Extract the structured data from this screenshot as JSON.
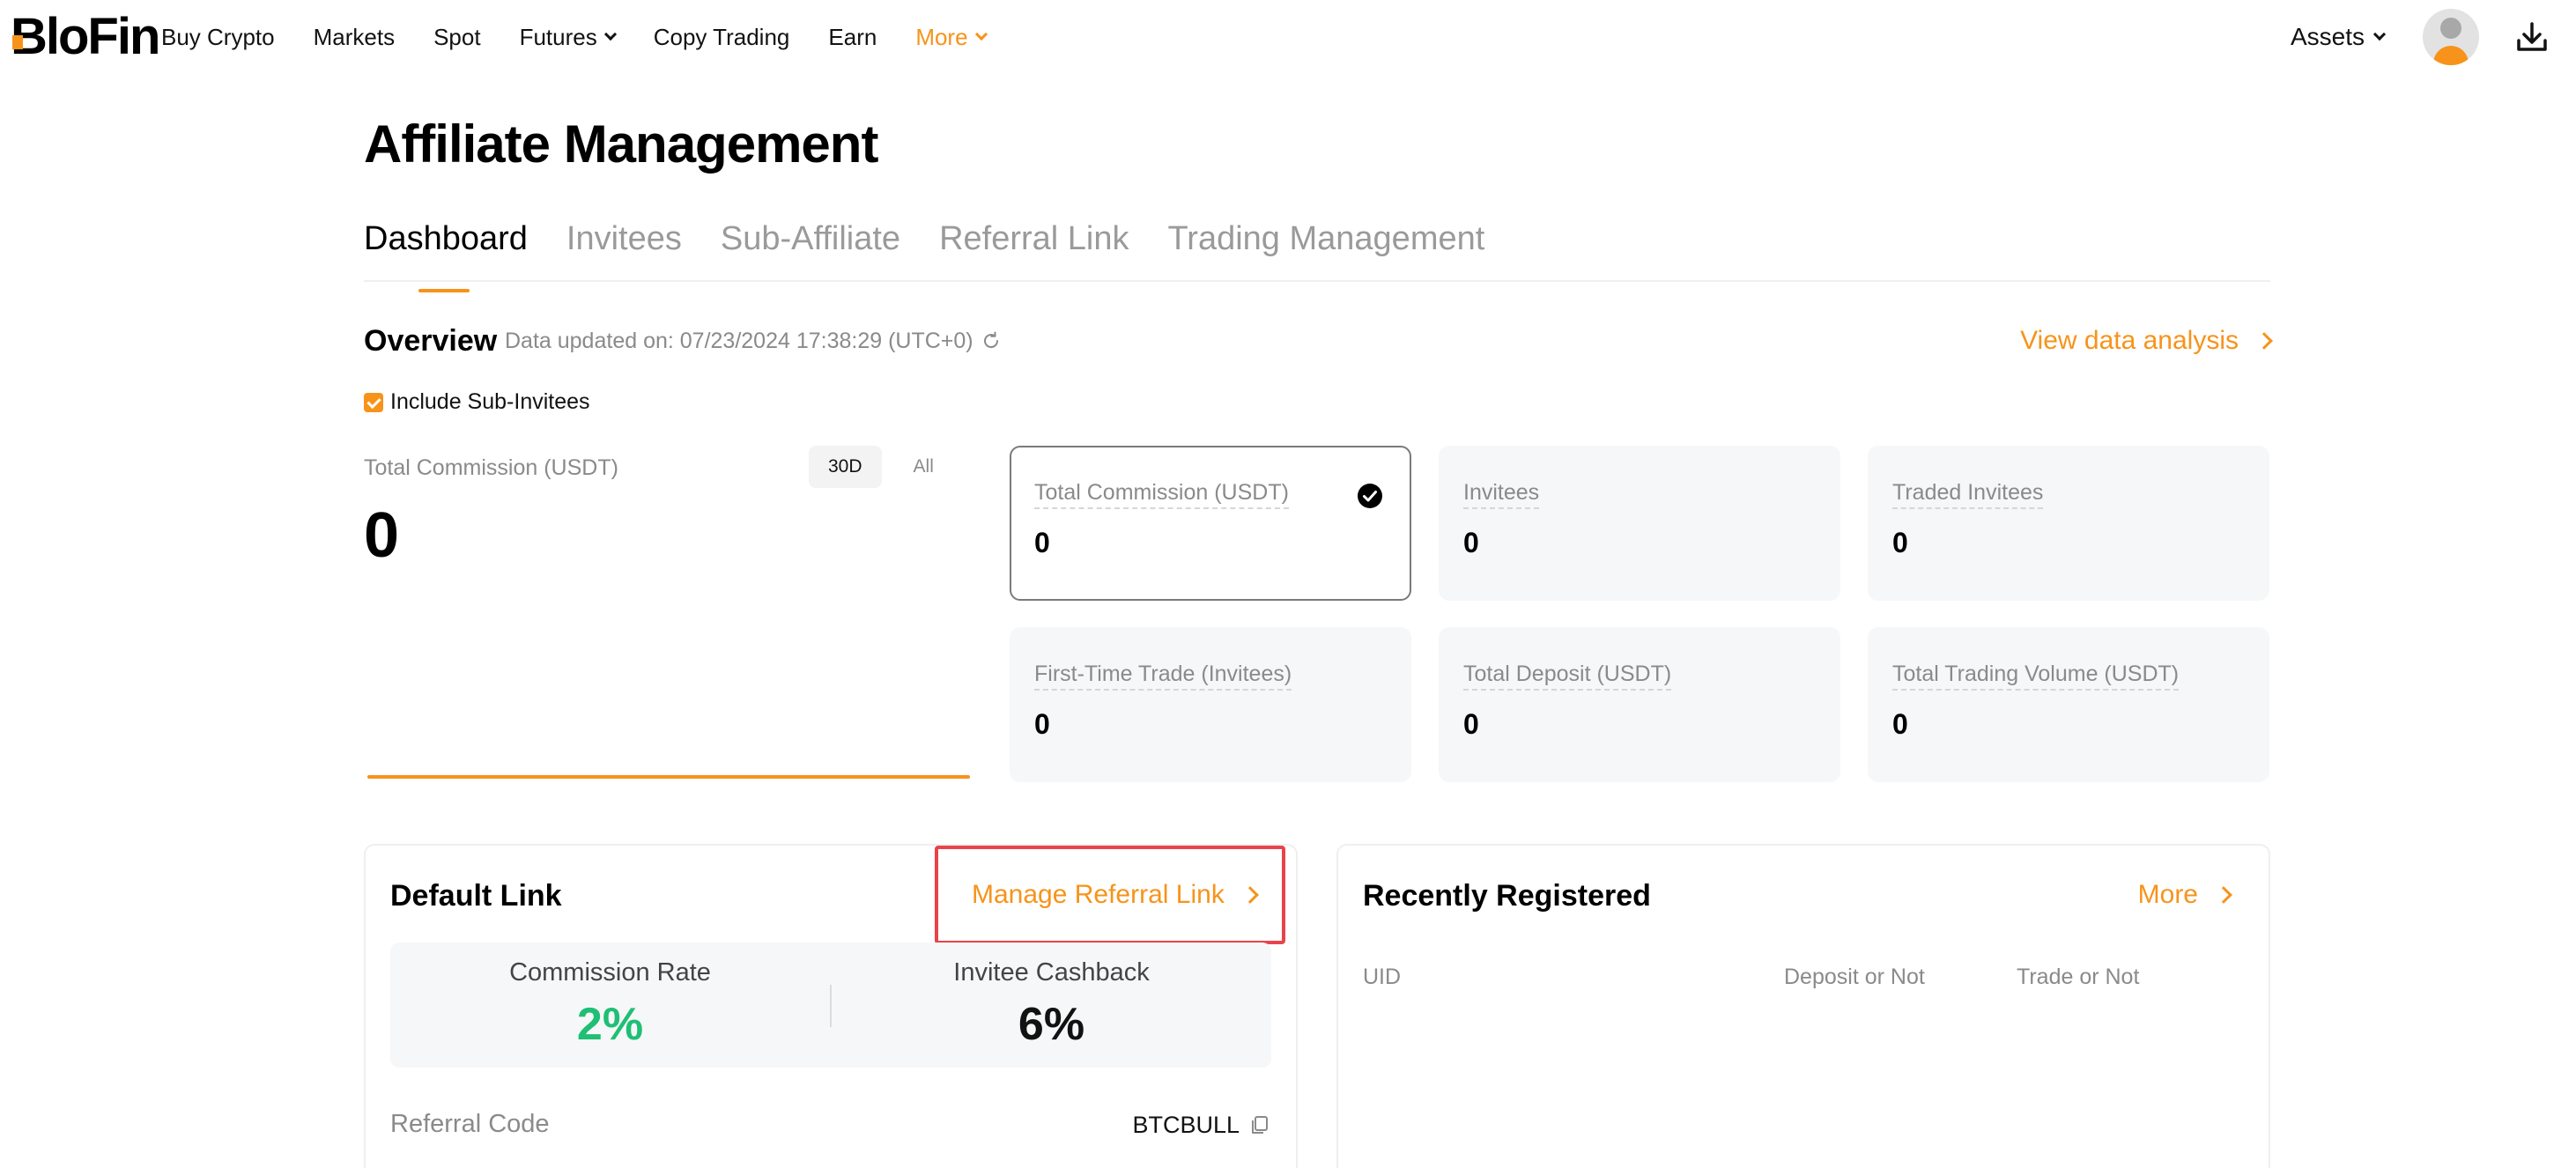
{
  "brand": {
    "logo_text": "BloFin",
    "accent_color": "#f7931a"
  },
  "nav": {
    "items": [
      {
        "label": "Buy Crypto",
        "has_chevron": false,
        "accent": false
      },
      {
        "label": "Markets",
        "has_chevron": false,
        "accent": false
      },
      {
        "label": "Spot",
        "has_chevron": false,
        "accent": false
      },
      {
        "label": "Futures",
        "has_chevron": true,
        "accent": false
      },
      {
        "label": "Copy Trading",
        "has_chevron": false,
        "accent": false
      },
      {
        "label": "Earn",
        "has_chevron": false,
        "accent": false
      },
      {
        "label": "More",
        "has_chevron": true,
        "accent": true
      }
    ],
    "assets_label": "Assets"
  },
  "page": {
    "title": "Affiliate Management",
    "tabs": [
      {
        "label": "Dashboard",
        "active": true
      },
      {
        "label": "Invitees",
        "active": false
      },
      {
        "label": "Sub-Affiliate",
        "active": false
      },
      {
        "label": "Referral Link",
        "active": false
      },
      {
        "label": "Trading Management",
        "active": false
      }
    ]
  },
  "overview": {
    "title": "Overview",
    "updated": "Data updated on: 07/23/2024 17:38:29 (UTC+0)",
    "view_analysis": "View data analysis",
    "include_sub_invitees": "Include Sub-Invitees",
    "include_checked": true,
    "commission_label": "Total Commission (USDT)",
    "range_options": [
      "30D",
      "All"
    ],
    "range_selected": "30D",
    "commission_value": "0",
    "stats": [
      {
        "label": "Total Commission (USDT)",
        "value": "0",
        "selected": true
      },
      {
        "label": "Invitees",
        "value": "0",
        "selected": false
      },
      {
        "label": "Traded Invitees",
        "value": "0",
        "selected": false
      },
      {
        "label": "First-Time Trade (Invitees)",
        "value": "0",
        "selected": false
      },
      {
        "label": "Total Deposit (USDT)",
        "value": "0",
        "selected": false
      },
      {
        "label": "Total Trading Volume (USDT)",
        "value": "0",
        "selected": false
      }
    ]
  },
  "default_link": {
    "title": "Default Link",
    "manage_label": "Manage Referral Link",
    "commission_rate_label": "Commission Rate",
    "commission_rate_value": "2%",
    "invitee_cashback_label": "Invitee Cashback",
    "invitee_cashback_value": "6%",
    "referral_code_label": "Referral Code",
    "referral_code_value": "BTCBULL",
    "highlight_color": "#e9434a",
    "positive_color": "#1fbf75"
  },
  "recently_registered": {
    "title": "Recently Registered",
    "more_label": "More",
    "columns": [
      "UID",
      "Deposit or Not",
      "Trade or Not"
    ]
  }
}
